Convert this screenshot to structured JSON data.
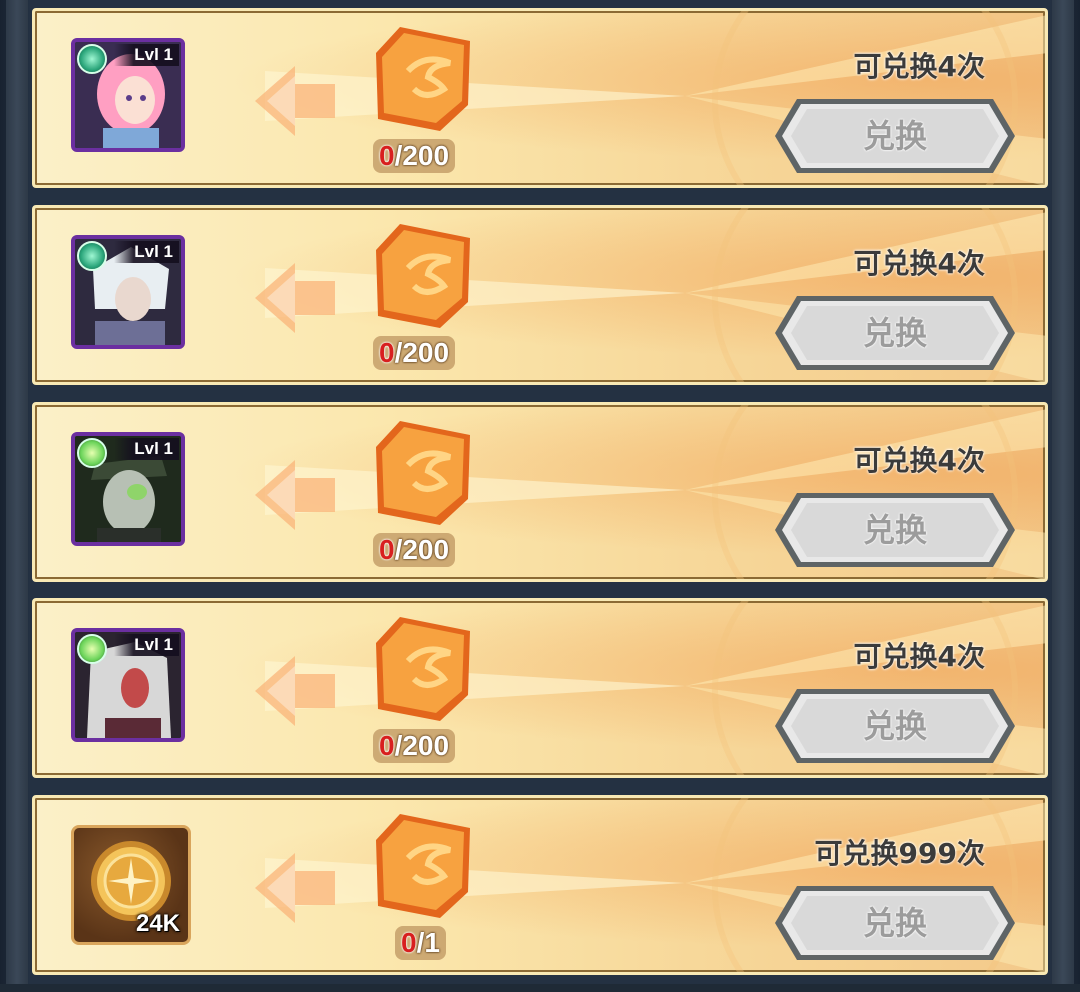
{
  "rows": [
    {
      "item_type": "hero",
      "level_label": "Lvl 1",
      "element_color": "#2aa57a",
      "hair_color": "#ff9fc2",
      "cost_current": "0",
      "cost_total": "/200",
      "remaining_text": "可兑换4次",
      "button_label": "兑换"
    },
    {
      "item_type": "hero",
      "level_label": "Lvl 1",
      "element_color": "#2aa57a",
      "hair_color": "#e8eef2",
      "cost_current": "0",
      "cost_total": "/200",
      "remaining_text": "可兑换4次",
      "button_label": "兑换"
    },
    {
      "item_type": "hero",
      "level_label": "Lvl 1",
      "element_color": "#6bd45a",
      "hair_color": "#b7c0b4",
      "cost_current": "0",
      "cost_total": "/200",
      "remaining_text": "可兑换4次",
      "button_label": "兑换"
    },
    {
      "item_type": "hero",
      "level_label": "Lvl 1",
      "element_color": "#6bd45a",
      "hair_color": "#d7d7d7",
      "cost_current": "0",
      "cost_total": "/200",
      "remaining_text": "可兑换4次",
      "button_label": "兑换"
    },
    {
      "item_type": "gold",
      "quantity": "24K",
      "cost_current": "0",
      "cost_total": "/1",
      "remaining_text": "可兑换999次",
      "button_label": "兑换"
    }
  ],
  "colors": {
    "gem": "#f58a2c",
    "button_gray": "#9c9c9c",
    "cost_current_red": "#d81f1f"
  },
  "icons": {
    "gem": "orange-rune-gem-icon",
    "arrow": "left-arrow-icon",
    "coin": "gold-coin-icon"
  }
}
